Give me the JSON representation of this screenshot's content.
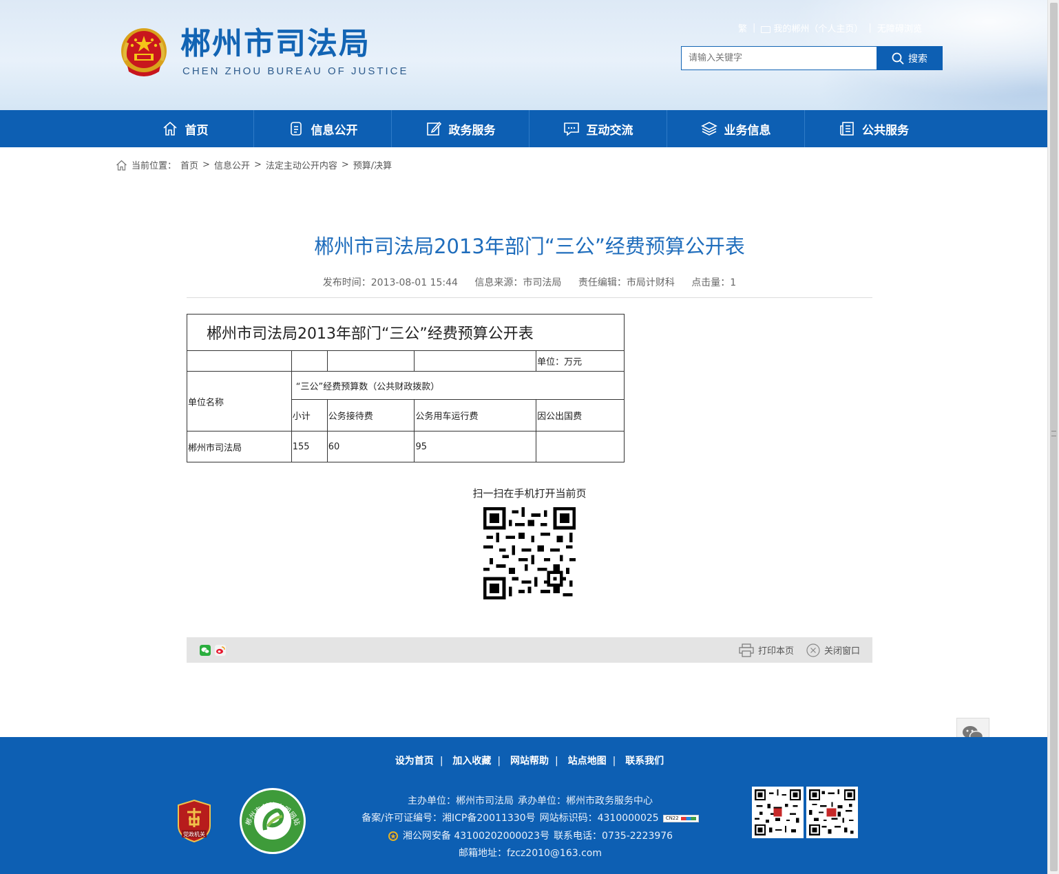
{
  "header": {
    "site_title": "郴州市司法局",
    "site_subtitle": "CHEN ZHOU BUREAU OF JUSTICE",
    "top_links": {
      "traditional": "繁",
      "my_chenzhou": "我的郴州（个人主页）",
      "accessibility": "无障碍浏览"
    },
    "search": {
      "placeholder": "请输入关键字",
      "button_label": "搜索"
    }
  },
  "nav": {
    "items": [
      {
        "label": "首页",
        "icon": "home-icon"
      },
      {
        "label": "信息公开",
        "icon": "document-icon"
      },
      {
        "label": "政务服务",
        "icon": "edit-icon"
      },
      {
        "label": "互动交流",
        "icon": "chat-icon"
      },
      {
        "label": "业务信息",
        "icon": "layers-icon"
      },
      {
        "label": "公共服务",
        "icon": "newspaper-icon"
      }
    ]
  },
  "breadcrumb": {
    "prefix": "当前位置：",
    "items": [
      "首页",
      "信息公开",
      "法定主动公开内容",
      "预算/决算"
    ],
    "separator": ">"
  },
  "article": {
    "title": "郴州市司法局2013年部门“三公”经费预算公开表",
    "meta": {
      "publish_time": "发布时间：2013-08-01 15:44",
      "source": "信息来源：市司法局",
      "editor": "责任编辑：市局计财科",
      "clicks": "点击量：1"
    },
    "table": {
      "title": "郴州市司法局2013年部门“三公”经费预算公开表",
      "unit": "单位：万元",
      "unit_name_header": "单位名称",
      "group_header": "“三公”经费预算数（公共财政拨款）",
      "columns": [
        "小计",
        "公务接待费",
        "公务用车运行费",
        "因公出国费"
      ],
      "rows": [
        {
          "name": "郴州市司法局",
          "values": [
            "155",
            "60",
            "95",
            ""
          ]
        }
      ]
    },
    "qr_caption": "扫一扫在手机打开当前页"
  },
  "toolbar": {
    "print_label": "打印本页",
    "close_label": "关闭窗口"
  },
  "footer": {
    "links": [
      "设为首页",
      "加入收藏",
      "网站帮助",
      "站点地图",
      "联系我们"
    ],
    "sponsor": "主办单位：郴州市司法局",
    "organizer": "承办单位：郴州市政务服务中心",
    "icp": "备案/许可证编号：湘ICP备20011330号",
    "site_code": "网站标识码：4310000025",
    "police": "湘公网安备 43100202000023号",
    "phone": "联系电话：0735-2223976",
    "email": "邮箱地址：fzcz2010@163.com",
    "party_badge_text": "党政机关",
    "civ_badge_text": "郴州市创建文明网站",
    "cn22_badge": "CN22"
  },
  "colors": {
    "primary_blue": "#0d5fb3",
    "title_blue": "#1f6dbc",
    "toolbar_gray": "#e4e4e4"
  }
}
